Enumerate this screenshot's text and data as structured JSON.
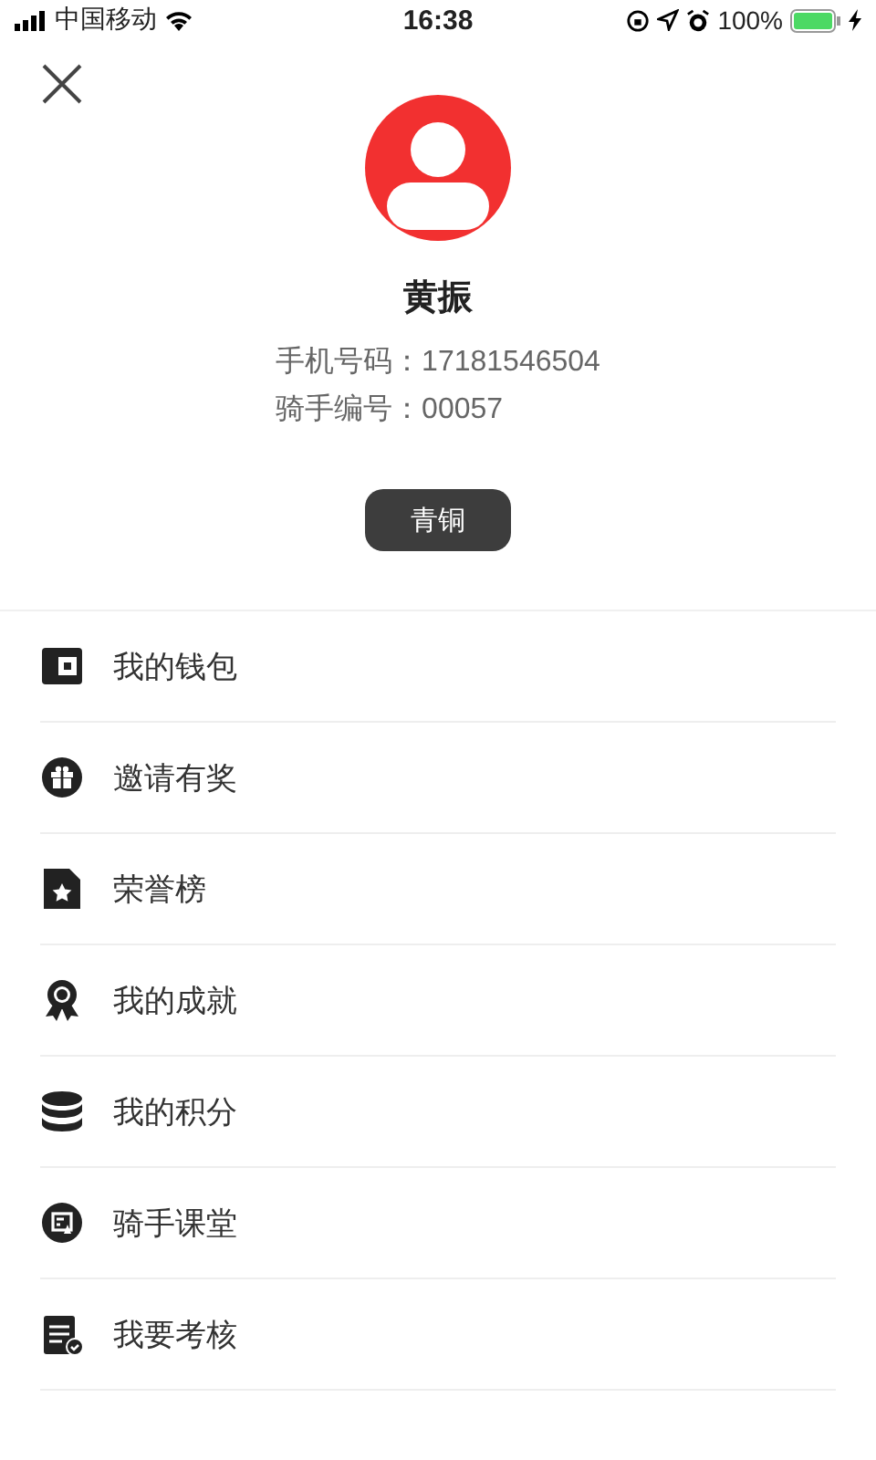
{
  "status_bar": {
    "carrier": "中国移动",
    "time": "16:38",
    "battery": "100%"
  },
  "profile": {
    "name": "黄振",
    "phone_label": "手机号码：",
    "phone": "17181546504",
    "rider_label": "骑手编号：",
    "rider_id": "00057",
    "level_badge": "青铜"
  },
  "menu": [
    {
      "kind": "wallet",
      "label": "我的钱包"
    },
    {
      "kind": "gift",
      "label": "邀请有奖"
    },
    {
      "kind": "honor",
      "label": "荣誉榜"
    },
    {
      "kind": "award",
      "label": "我的成就"
    },
    {
      "kind": "points",
      "label": "我的积分"
    },
    {
      "kind": "class",
      "label": "骑手课堂"
    },
    {
      "kind": "exam",
      "label": "我要考核"
    }
  ]
}
